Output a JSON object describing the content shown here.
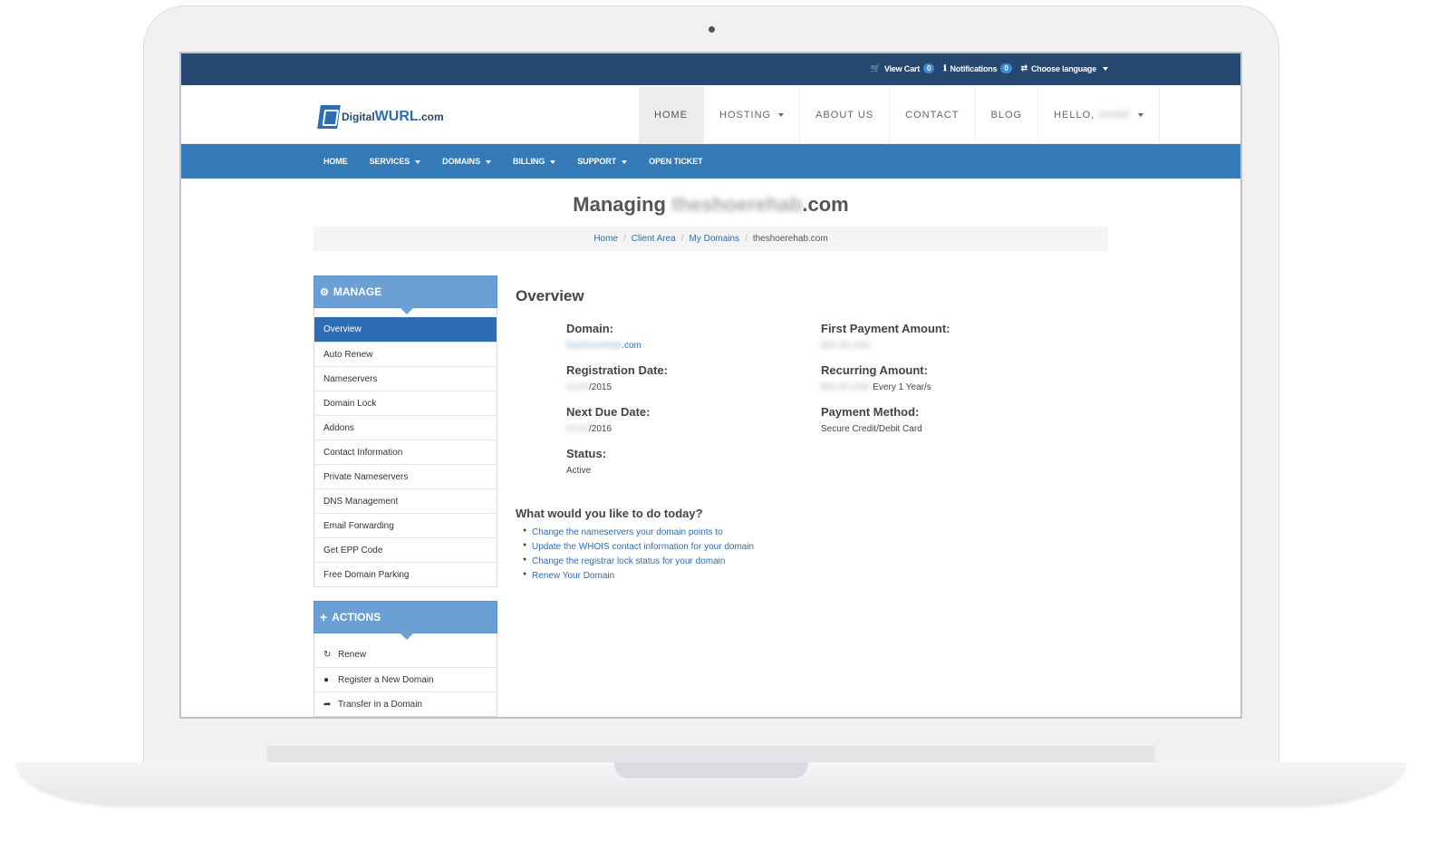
{
  "topbar": {
    "items": [
      {
        "icon": "cart-icon",
        "label": "View Cart",
        "badge": "0"
      },
      {
        "icon": "info-icon",
        "label": "Notifications",
        "badge": "0"
      },
      {
        "icon": "language-icon",
        "label": "Choose language"
      }
    ]
  },
  "header": {
    "logo_prefix": "Digital",
    "logo_brand": "WURL",
    "logo_suffix": ".com",
    "nav": [
      "HOME",
      "HOSTING",
      "ABOUT US",
      "CONTACT",
      "BLOG",
      "HELLO,"
    ],
    "user_name": "NAME"
  },
  "subnav": [
    "HOME",
    "SERVICES",
    "DOMAINS",
    "BILLING",
    "SUPPORT",
    "OPEN TICKET"
  ],
  "page": {
    "title_prefix": "Managing",
    "title_domain": "theshoerehab",
    "title_suffix": ".com"
  },
  "breadcrumb": [
    "Home",
    "Client Area",
    "My Domains",
    "theshoerehab.com"
  ],
  "manage_panel": {
    "title": "MANAGE",
    "items": [
      "Overview",
      "Auto Renew",
      "Nameservers",
      "Domain Lock",
      "Addons",
      "Contact Information",
      "Private Nameservers",
      "DNS Management",
      "Email Forwarding",
      "Get EPP Code",
      "Free Domain Parking"
    ]
  },
  "actions_panel": {
    "title": "ACTIONS",
    "items": [
      {
        "icon": "refresh-icon",
        "label": "Renew"
      },
      {
        "icon": "globe-icon",
        "label": "Register a New Domain"
      },
      {
        "icon": "share-icon",
        "label": "Transfer in a Domain"
      }
    ]
  },
  "overview": {
    "heading": "Overview",
    "domain_label": "Domain:",
    "domain_blur": "theshoerehab",
    "domain_suffix": ".com",
    "reg_label": "Registration Date:",
    "reg_blur": "01/15",
    "reg_year": "/2015",
    "due_label": "Next Due Date:",
    "due_blur": "01/15",
    "due_year": "/2016",
    "status_label": "Status:",
    "status_value": "Active",
    "first_label": "First Payment Amount:",
    "first_blur": "$00.00 USD",
    "recurring_label": "Recurring Amount:",
    "recurring_blur": "$00.00 USD",
    "recurring_suffix": "Every 1 Year/s",
    "method_label": "Payment Method:",
    "method_value": "Secure Credit/Debit Card"
  },
  "todo": {
    "heading": "What would you like to do today?",
    "items": [
      "Change the nameservers your domain points to",
      "Update the WHOIS contact information for your domain",
      "Change the registrar lock status for your domain",
      "Renew Your Domain"
    ]
  }
}
